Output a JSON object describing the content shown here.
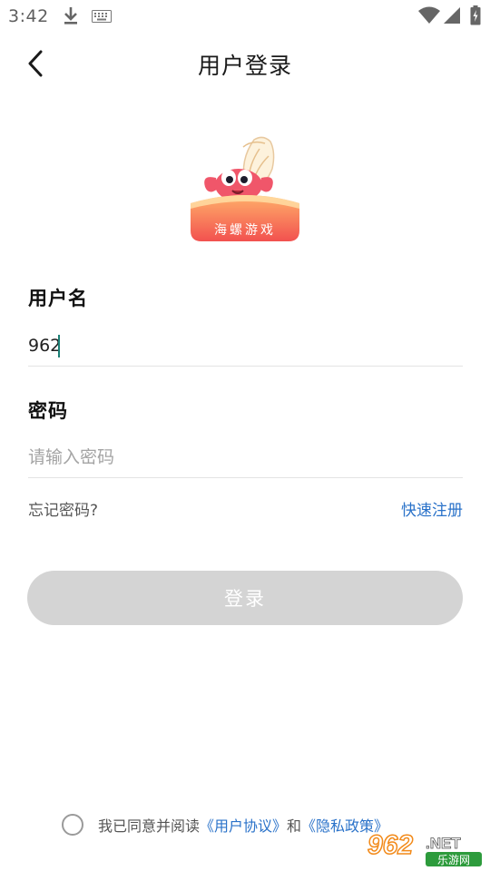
{
  "status_bar": {
    "time": "3:42",
    "icons": [
      "download-icon",
      "keyboard-icon",
      "wifi-icon",
      "signal-icon",
      "battery-icon"
    ]
  },
  "header": {
    "back_icon": "chevron-left-icon",
    "title": "用户登录"
  },
  "logo": {
    "text": "海螺游戏",
    "colors": {
      "banner_top": "#ff9a5c",
      "banner_bottom": "#f3524f",
      "crab": "#f0566a",
      "shell": "#fdf2dc"
    }
  },
  "form": {
    "username": {
      "label": "用户名",
      "value": "962"
    },
    "password": {
      "label": "密码",
      "value": "",
      "placeholder": "请输入密码"
    },
    "forgot_label": "忘记密码?",
    "register_label": "快速注册",
    "login_label": "登录"
  },
  "agreement": {
    "checked": false,
    "prefix": "我已同意并阅读",
    "user_agreement": "《用户协议》",
    "conjunction": "和",
    "privacy_policy": "《隐私政策》"
  },
  "watermark": {
    "main": "962",
    "suffix": ".NET",
    "sub": "乐游网"
  },
  "colors": {
    "accent_link": "#2a72c9",
    "button_disabled": "#d4d4d4",
    "caret": "#1a7f75"
  }
}
